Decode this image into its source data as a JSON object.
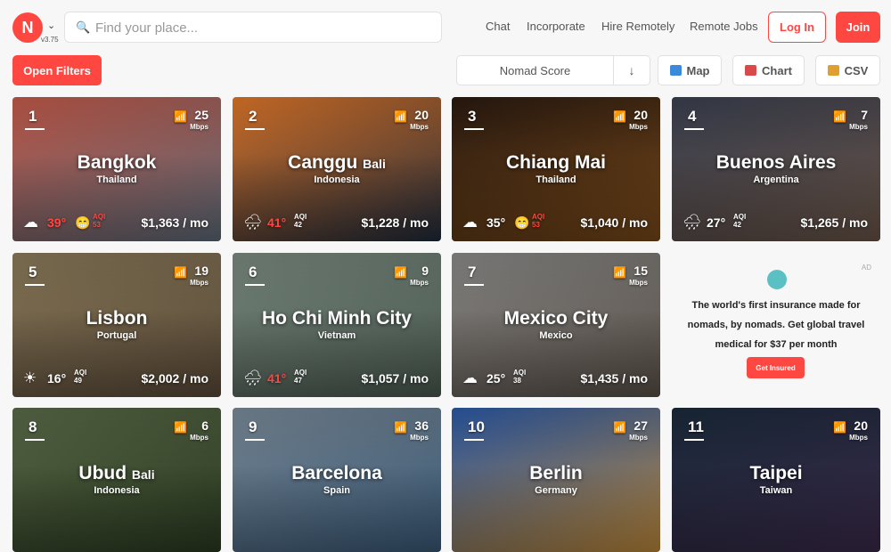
{
  "header": {
    "logo_text": "N",
    "version": "v3.75",
    "search": {
      "placeholder": "Find your place..."
    },
    "nav": [
      "Chat",
      "Incorporate",
      "Hire Remotely",
      "Remote Jobs"
    ],
    "login": "Log In",
    "join": "Join"
  },
  "toolbar": {
    "filters": "Open Filters",
    "sort_label": "Nomad Score",
    "sort_direction": "↓",
    "views": [
      {
        "label": "Map",
        "icon": "map-icon",
        "color": "#3a8ad9"
      },
      {
        "label": "Chart",
        "icon": "chart-icon",
        "color": "#d94a4a"
      },
      {
        "label": "CSV",
        "icon": "folder-icon",
        "color": "#e0a030"
      }
    ]
  },
  "cities": [
    {
      "rank": "1",
      "city": "Bangkok",
      "suffix": "",
      "country": "Thailand",
      "speed": "25",
      "unit": "Mbps",
      "weather": "cloudy-icon",
      "weather_glyph": "☁",
      "temp": "39°",
      "hot": true,
      "aqi": "53",
      "aqi_bad": true,
      "face": "😁",
      "price": "$1,363 / mo",
      "bg": [
        "#c45a4a",
        "#5d6a78"
      ]
    },
    {
      "rank": "2",
      "city": "Canggu",
      "suffix": "Bali",
      "country": "Indonesia",
      "speed": "20",
      "unit": "Mbps",
      "weather": "rain-icon",
      "weather_glyph": "🌧",
      "temp": "41°",
      "hot": true,
      "aqi": "42",
      "aqi_bad": false,
      "face": "",
      "price": "$1,228 / mo",
      "bg": [
        "#e0772a",
        "#1e2a3a"
      ]
    },
    {
      "rank": "3",
      "city": "Chiang Mai",
      "suffix": "",
      "country": "Thailand",
      "speed": "20",
      "unit": "Mbps",
      "weather": "cloudy-icon",
      "weather_glyph": "☁",
      "temp": "35°",
      "hot": false,
      "aqi": "53",
      "aqi_bad": true,
      "face": "😁",
      "price": "$1,040 / mo",
      "bg": [
        "#2a1a10",
        "#7a4a1a"
      ]
    },
    {
      "rank": "4",
      "city": "Buenos Aires",
      "suffix": "",
      "country": "Argentina",
      "speed": "7",
      "unit": "Mbps",
      "weather": "rain-icon",
      "weather_glyph": "🌧",
      "temp": "27°",
      "hot": false,
      "aqi": "42",
      "aqi_bad": false,
      "face": "",
      "price": "$1,265 / mo",
      "bg": [
        "#3a4050",
        "#6a5548"
      ]
    },
    {
      "rank": "5",
      "city": "Lisbon",
      "suffix": "",
      "country": "Portugal",
      "speed": "19",
      "unit": "Mbps",
      "weather": "sun-icon",
      "weather_glyph": "☀",
      "temp": "16°",
      "hot": false,
      "aqi": "49",
      "aqi_bad": false,
      "face": "",
      "price": "$2,002 / mo",
      "bg": [
        "#8a7a5a",
        "#5a4a38"
      ]
    },
    {
      "rank": "6",
      "city": "Ho Chi Minh City",
      "suffix": "",
      "country": "Vietnam",
      "speed": "9",
      "unit": "Mbps",
      "weather": "rain-icon",
      "weather_glyph": "🌧",
      "temp": "41°",
      "hot": true,
      "aqi": "47",
      "aqi_bad": false,
      "face": "",
      "price": "$1,057 / mo",
      "bg": [
        "#7a8a80",
        "#4a5a50"
      ]
    },
    {
      "rank": "7",
      "city": "Mexico City",
      "suffix": "",
      "country": "Mexico",
      "speed": "15",
      "unit": "Mbps",
      "weather": "cloudy-icon",
      "weather_glyph": "☁",
      "temp": "25°",
      "hot": false,
      "aqi": "38",
      "aqi_bad": false,
      "face": "",
      "price": "$1,435 / mo",
      "bg": [
        "#8a8a88",
        "#5a5048"
      ]
    },
    {
      "rank": "8",
      "city": "Ubud",
      "suffix": "Bali",
      "country": "Indonesia",
      "speed": "6",
      "unit": "Mbps",
      "weather": "",
      "weather_glyph": "",
      "temp": "",
      "hot": false,
      "aqi": "",
      "aqi_bad": false,
      "face": "",
      "price": "",
      "bg": [
        "#5a6a48",
        "#2a3a20"
      ]
    },
    {
      "rank": "9",
      "city": "Barcelona",
      "suffix": "",
      "country": "Spain",
      "speed": "36",
      "unit": "Mbps",
      "weather": "",
      "weather_glyph": "",
      "temp": "",
      "hot": false,
      "aqi": "",
      "aqi_bad": false,
      "face": "",
      "price": "",
      "bg": [
        "#7a8a98",
        "#3a5a78"
      ]
    },
    {
      "rank": "10",
      "city": "Berlin",
      "suffix": "",
      "country": "Germany",
      "speed": "27",
      "unit": "Mbps",
      "weather": "",
      "weather_glyph": "",
      "temp": "",
      "hot": false,
      "aqi": "",
      "aqi_bad": false,
      "face": "",
      "price": "",
      "bg": [
        "#2a5aa8",
        "#c08a3a"
      ]
    },
    {
      "rank": "11",
      "city": "Taipei",
      "suffix": "",
      "country": "Taiwan",
      "speed": "20",
      "unit": "Mbps",
      "weather": "",
      "weather_glyph": "",
      "temp": "",
      "hot": false,
      "aqi": "",
      "aqi_bad": false,
      "face": "",
      "price": "",
      "bg": [
        "#1a2a3a",
        "#3a2a4a"
      ]
    }
  ],
  "aqi_label": "AQI",
  "ad": {
    "label": "AD",
    "text": "The world's first insurance made for nomads, by nomads. Get global travel medical for $37 per month",
    "button": "Get Insured"
  }
}
